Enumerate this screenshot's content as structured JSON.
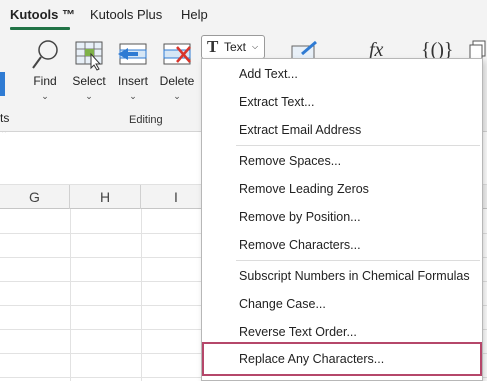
{
  "menubar": {
    "tabs": [
      {
        "label": "Kutools ™",
        "active": true
      },
      {
        "label": "Kutools Plus",
        "active": false
      },
      {
        "label": "Help",
        "active": false
      }
    ]
  },
  "ribbon": {
    "left_edge_label": "ts",
    "buttons": {
      "find": "Find",
      "select": "Select",
      "insert": "Insert",
      "delete": "Delete"
    },
    "group_label": "Editing",
    "text_button": "Text"
  },
  "columns": [
    "G",
    "H",
    "I"
  ],
  "dropdown": {
    "items": [
      "Add Text...",
      "Extract Text...",
      "Extract Email Address",
      "Remove Spaces...",
      "Remove Leading Zeros",
      "Remove by Position...",
      "Remove Characters...",
      "Subscript Numbers in Chemical Formulas",
      "Change Case...",
      "Reverse Text Order...",
      "Replace Any Characters..."
    ]
  },
  "colors": {
    "accent": "#217346",
    "highlight_border": "#b5476a",
    "ribbon_bg": "#f3f3f3"
  }
}
